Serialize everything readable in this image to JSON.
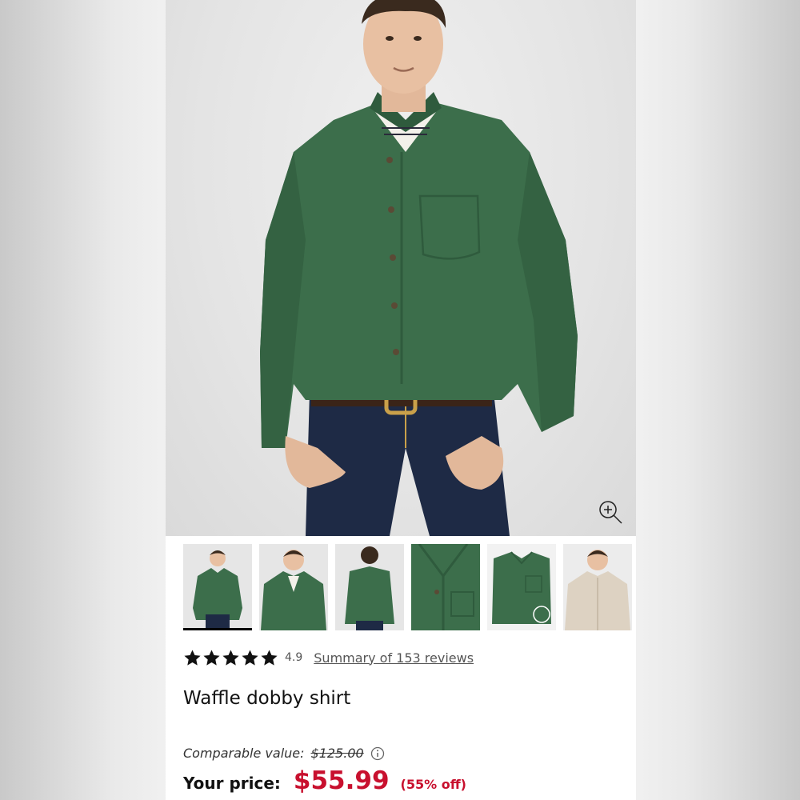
{
  "gallery": {
    "zoom_icon": "zoom-in-icon",
    "thumbnails": [
      {
        "name": "front-view",
        "selected": true
      },
      {
        "name": "front-unbuttoned"
      },
      {
        "name": "back-view"
      },
      {
        "name": "fabric-detail"
      },
      {
        "name": "folded-shirt"
      },
      {
        "name": "alternate-color-stone"
      }
    ]
  },
  "rating": {
    "stars": 5,
    "value": "4.9",
    "reviews_link": "Summary of 153 reviews"
  },
  "product": {
    "title": "Waffle dobby shirt"
  },
  "pricing": {
    "comparable_label": "Comparable value:",
    "comparable_price": "$125.00",
    "your_price_label": "Your price:",
    "price": "$55.99",
    "discount": "(55% off)"
  },
  "colors": {
    "price_red": "#c8102e",
    "shirt_green": "#3c6e4b"
  }
}
